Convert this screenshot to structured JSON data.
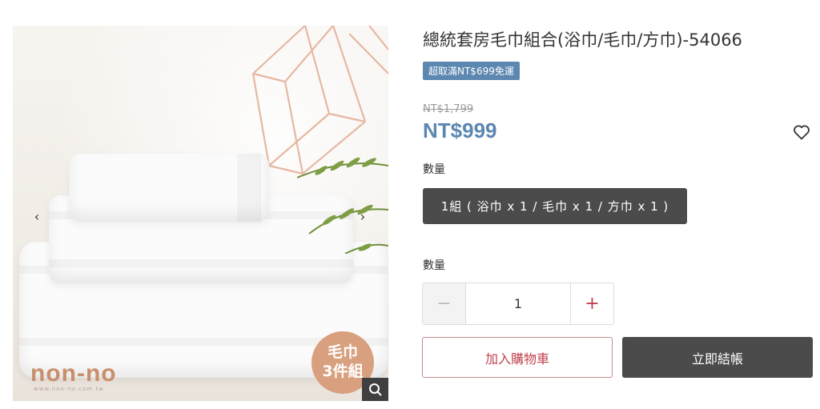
{
  "gallery": {
    "brand_logo": "non-no",
    "brand_url": "www.non-no.com.tw",
    "badge_line1": "毛巾",
    "badge_line2": "3件組",
    "prev_icon": "chevron-left-icon",
    "next_icon": "chevron-right-icon",
    "zoom_icon": "magnifier-icon"
  },
  "product": {
    "title": "總統套房毛巾組合(浴巾/毛巾/方巾)-54066",
    "promo_tag": "超取滿NT$699免運",
    "original_price": "NT$1,799",
    "price": "NT$999",
    "favorite_icon": "heart-outline-icon"
  },
  "options": {
    "variant_label": "數量",
    "variant_value": "1組 ( 浴巾 x 1 / 毛巾 x 1 / 方巾 x 1 )",
    "quantity_label": "數量",
    "quantity_value": "1",
    "minus_symbol": "−",
    "plus_symbol": "+"
  },
  "actions": {
    "add_to_cart": "加入購物車",
    "buy_now": "立即結帳"
  },
  "colors": {
    "accent_blue": "#5b87b0",
    "accent_red": "#c1414d",
    "dark_button": "#4b4b4b"
  }
}
